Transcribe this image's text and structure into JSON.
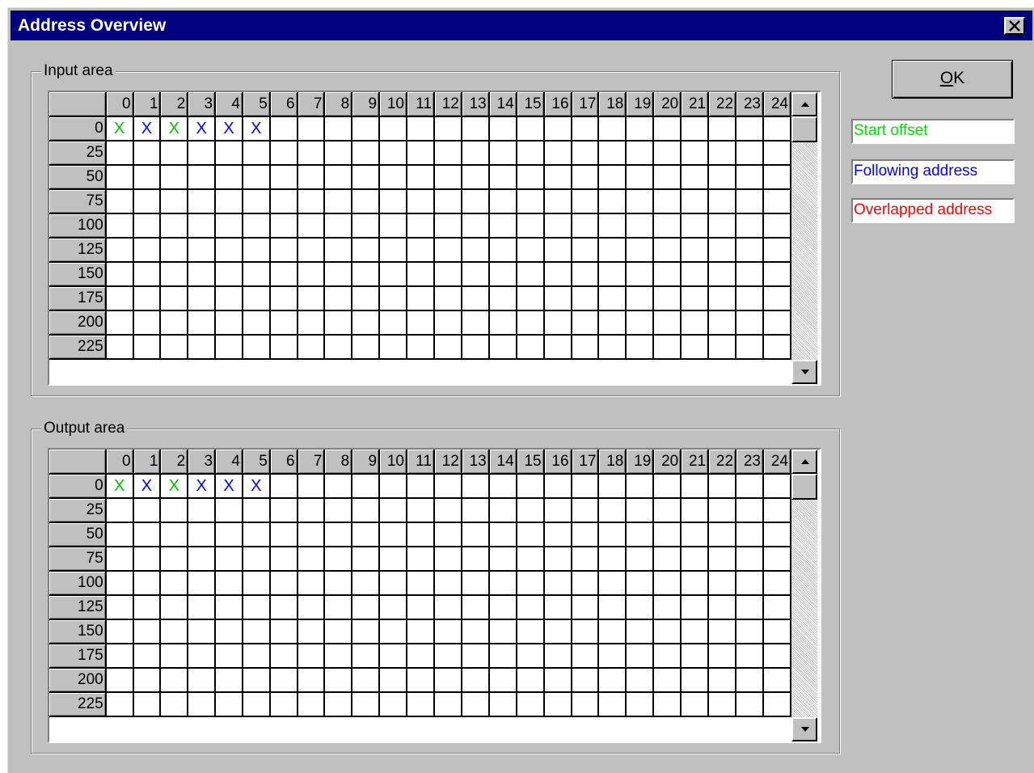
{
  "window": {
    "title": "Address Overview",
    "close_label": "close"
  },
  "input_area": {
    "label": "Input area",
    "column_headers": [
      "0",
      "1",
      "2",
      "3",
      "4",
      "5",
      "6",
      "7",
      "8",
      "9",
      "10",
      "11",
      "12",
      "13",
      "14",
      "15",
      "16",
      "17",
      "18",
      "19",
      "20",
      "21",
      "22",
      "23",
      "24"
    ],
    "row_headers": [
      "0",
      "25",
      "50",
      "75",
      "100",
      "125",
      "150",
      "175",
      "200",
      "225"
    ],
    "marks": [
      {
        "row": "0",
        "col": "0",
        "text": "X",
        "kind": "start"
      },
      {
        "row": "0",
        "col": "1",
        "text": "X",
        "kind": "following"
      },
      {
        "row": "0",
        "col": "2",
        "text": "X",
        "kind": "start"
      },
      {
        "row": "0",
        "col": "3",
        "text": "X",
        "kind": "following"
      },
      {
        "row": "0",
        "col": "4",
        "text": "X",
        "kind": "following"
      },
      {
        "row": "0",
        "col": "5",
        "text": "X",
        "kind": "following"
      }
    ]
  },
  "output_area": {
    "label": "Output area",
    "column_headers": [
      "0",
      "1",
      "2",
      "3",
      "4",
      "5",
      "6",
      "7",
      "8",
      "9",
      "10",
      "11",
      "12",
      "13",
      "14",
      "15",
      "16",
      "17",
      "18",
      "19",
      "20",
      "21",
      "22",
      "23",
      "24"
    ],
    "row_headers": [
      "0",
      "25",
      "50",
      "75",
      "100",
      "125",
      "150",
      "175",
      "200",
      "225"
    ],
    "marks": [
      {
        "row": "0",
        "col": "0",
        "text": "X",
        "kind": "start"
      },
      {
        "row": "0",
        "col": "1",
        "text": "X",
        "kind": "following"
      },
      {
        "row": "0",
        "col": "2",
        "text": "X",
        "kind": "start"
      },
      {
        "row": "0",
        "col": "3",
        "text": "X",
        "kind": "following"
      },
      {
        "row": "0",
        "col": "4",
        "text": "X",
        "kind": "following"
      },
      {
        "row": "0",
        "col": "5",
        "text": "X",
        "kind": "following"
      }
    ]
  },
  "buttons": {
    "ok_accel": "O",
    "ok_rest": "K"
  },
  "legend": {
    "start_offset": "Start offset",
    "following_address": "Following address",
    "overlapped_address": "Overlapped address"
  },
  "colors": {
    "title_bar": "#000080",
    "dialog_face": "#c0c0c0",
    "start_offset": "#00c000",
    "following_address": "#0000ff",
    "overlapped_address": "#ff0000"
  },
  "icons": {
    "close": "close-icon",
    "scroll_up": "scroll-up-arrow-icon",
    "scroll_down": "scroll-down-arrow-icon"
  }
}
